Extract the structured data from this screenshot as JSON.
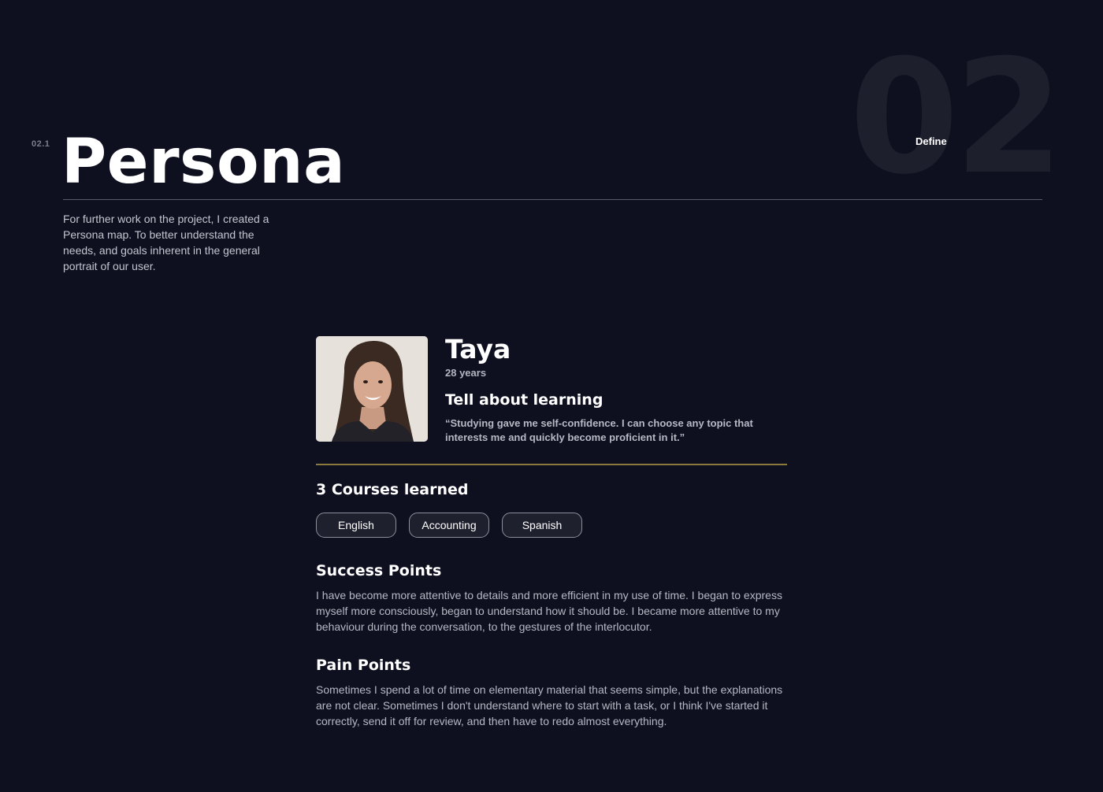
{
  "header": {
    "section_number": "02.1",
    "title": "Persona",
    "chapter_number": "02",
    "chapter_label": "Define",
    "intro": "For further work on the project, I created a Persona map. To better understand the needs, and goals inherent in the general portrait of our user."
  },
  "persona": {
    "photo_icon": "persona-photo",
    "name": "Taya",
    "age": "28 years",
    "learning_heading": "Tell about learning",
    "quote": "“Studying gave me self-confidence. I can choose any topic that interests me and quickly become proficient in it.”"
  },
  "courses": {
    "heading": "3 Courses learned",
    "items": [
      "English",
      "Accounting",
      "Spanish"
    ]
  },
  "success": {
    "heading": "Success Points",
    "text": "I have become more attentive to details and more efficient in my use of time. I began to express myself more consciously, began to understand how it should be. I became more attentive to my behaviour during the conversation, to the gestures of the interlocutor."
  },
  "pain": {
    "heading": "Pain Points",
    "text": "Sometimes I spend a lot of time on elementary material that seems simple, but the explanations are not clear. Sometimes I don't understand where to start with a task, or I think I've started it correctly, send it off for review, and then have to redo almost everything."
  },
  "colors": {
    "background": "#0e1020",
    "accent_rule": "#8a7a3c",
    "big_number": "#1e1f2d"
  }
}
